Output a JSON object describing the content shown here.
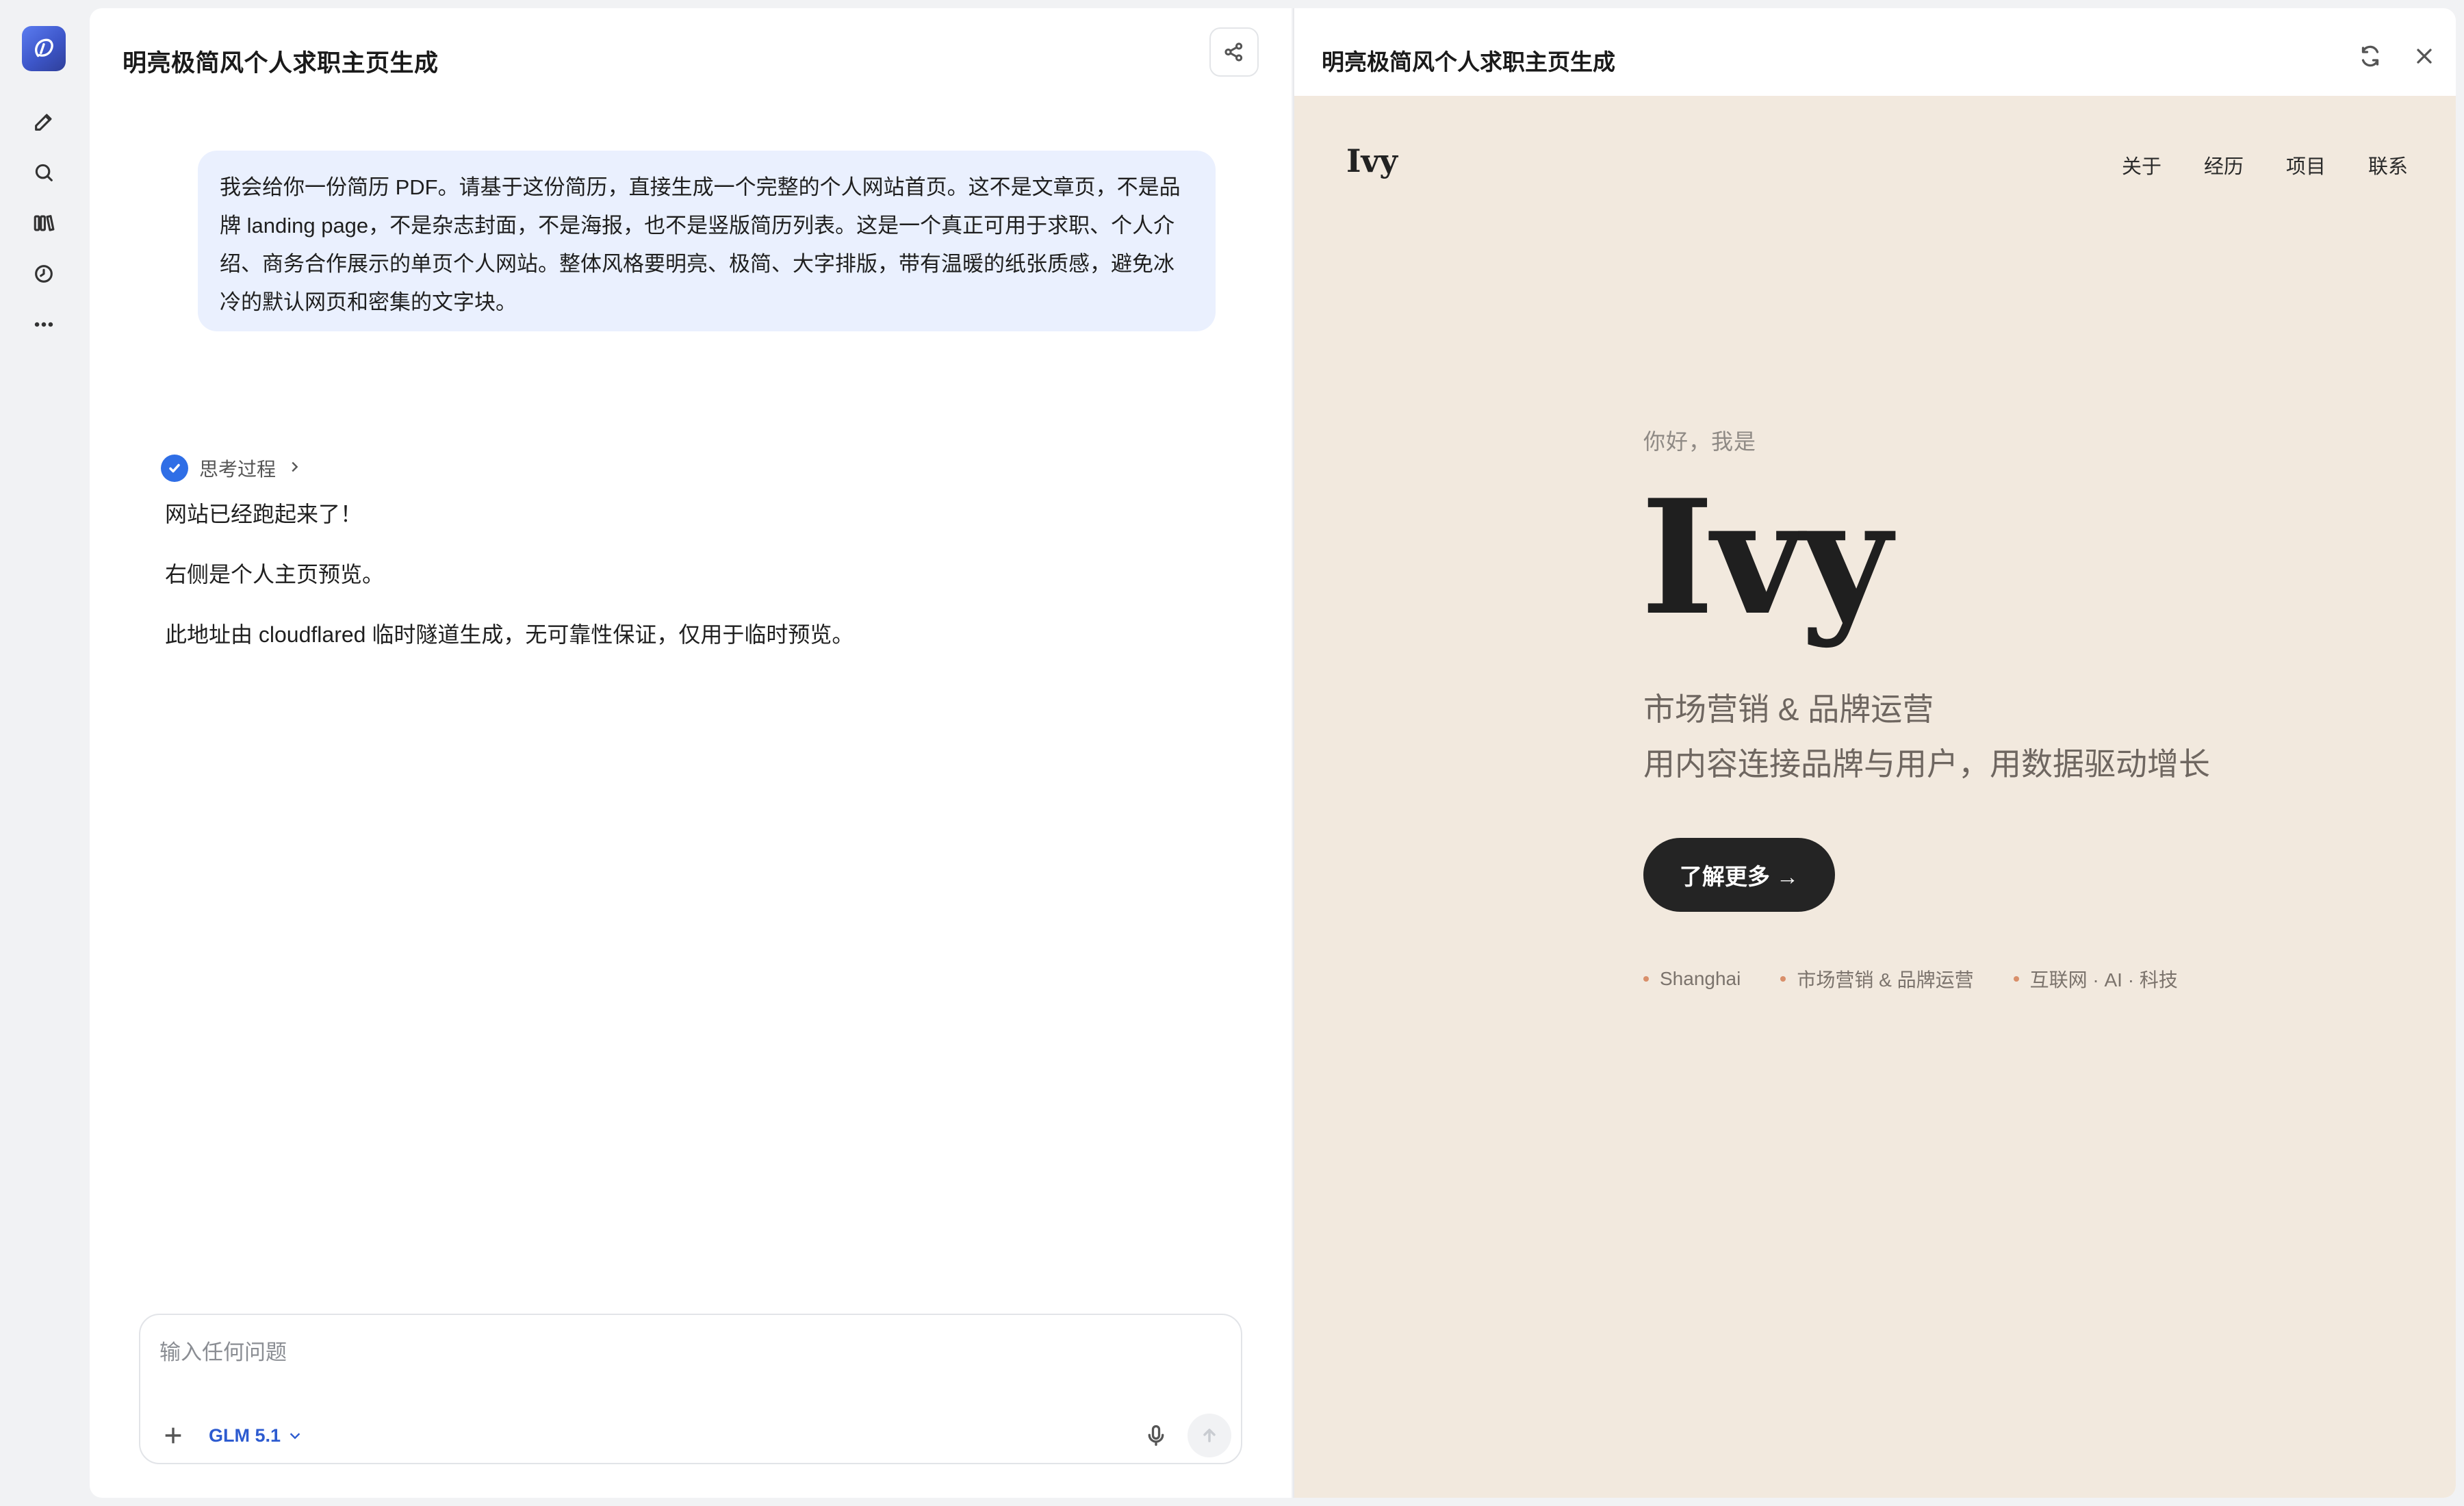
{
  "rail": {
    "icons": [
      "app-logo",
      "new-chat-icon",
      "search-icon",
      "library-icon",
      "history-icon",
      "more-icon"
    ]
  },
  "chat": {
    "title": "明亮极简风个人求职主页生成",
    "user_message": "我会给你一份简历 PDF。请基于这份简历，直接生成一个完整的个人网站首页。这不是文章页，不是品牌 landing page，不是杂志封面，不是海报，也不是竖版简历列表。这是一个真正可用于求职、个人介绍、商务合作展示的单页个人网站。整体风格要明亮、极简、大字排版，带有温暖的纸张质感，避免冰冷的默认网页和密集的文字块。",
    "thinking_label": "思考过程",
    "reply_lines": [
      "网站已经跑起来了！",
      "右侧是个人主页预览。",
      "此地址由 cloudflared 临时隧道生成，无可靠性保证，仅用于临时预览。"
    ],
    "composer": {
      "placeholder": "输入任何问题",
      "model": "GLM 5.1"
    }
  },
  "preview": {
    "title": "明亮极简风个人求职主页生成",
    "site": {
      "brand": "Ivy",
      "nav": [
        "关于",
        "经历",
        "项目",
        "联系"
      ],
      "greeting": "你好，我是",
      "name": "Ivy",
      "subtitle1": "市场营销 & 品牌运营",
      "subtitle2": "用内容连接品牌与用户，用数据驱动增长",
      "cta": "了解更多 →",
      "tags": [
        "Shanghai",
        "市场营销 & 品牌运营",
        "互联网 · AI · 科技"
      ]
    }
  },
  "colors": {
    "accent": "#2f6ee6",
    "bubble": "#eaf0fe",
    "site_bg": "#f2e9de",
    "cta_bg": "#242424",
    "tag_dot": "#d98f6a"
  }
}
